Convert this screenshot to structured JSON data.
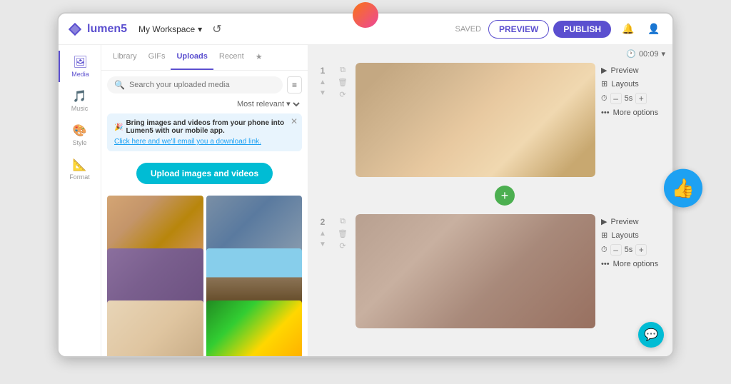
{
  "logo": {
    "text": "lumen5",
    "workspace": "My Workspace"
  },
  "topnav": {
    "saved_label": "SAVED",
    "preview_label": "PREVIEW",
    "publish_label": "PUBLISH",
    "time": "00:09"
  },
  "sidebar": {
    "items": [
      {
        "id": "media",
        "label": "Media",
        "icon": "🖼"
      },
      {
        "id": "music",
        "label": "Music",
        "icon": "🎵"
      },
      {
        "id": "style",
        "label": "Style",
        "icon": "🎨"
      },
      {
        "id": "format",
        "label": "Format",
        "icon": "📐"
      }
    ]
  },
  "media_panel": {
    "tabs": [
      {
        "id": "library",
        "label": "Library",
        "active": false
      },
      {
        "id": "gifs",
        "label": "GIFs",
        "active": false
      },
      {
        "id": "uploads",
        "label": "Uploads",
        "active": true
      },
      {
        "id": "recent",
        "label": "Recent",
        "active": false
      },
      {
        "id": "favorites",
        "label": "★",
        "active": false
      }
    ],
    "search_placeholder": "Search your uploaded media",
    "sort_label": "Most relevant ▾",
    "promo": {
      "emoji": "🎉",
      "title": "Bring images and videos from your phone into Lumen5 with our mobile app.",
      "link_text": "Click here and we'll email you a download link."
    },
    "upload_btn": "Upload images and videos"
  },
  "slides": [
    {
      "number": "1",
      "actions": [
        "Preview",
        "Layouts",
        "– 5s +",
        "More options"
      ]
    },
    {
      "number": "2",
      "actions": [
        "Preview",
        "Layouts",
        "– 5s +",
        "More options"
      ]
    }
  ],
  "chat_icon": "💬",
  "thumbs_up_icon": "👍"
}
